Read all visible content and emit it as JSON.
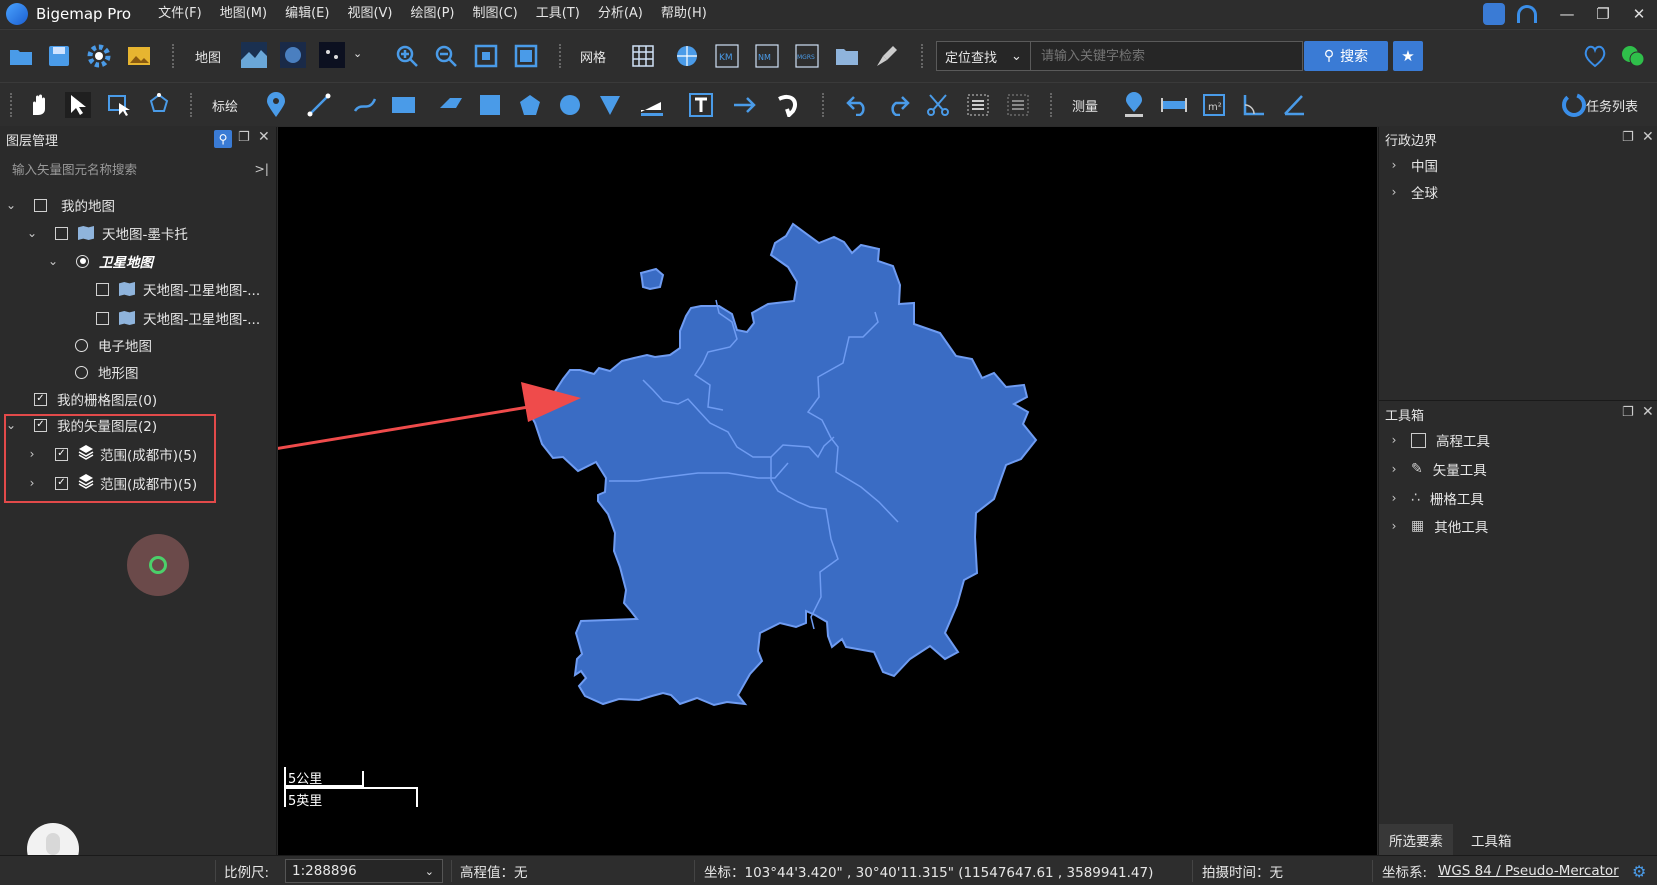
{
  "app": {
    "name": "Bigemap Pro"
  },
  "menu": [
    "文件(F)",
    "地图(M)",
    "编辑(E)",
    "视图(V)",
    "绘图(P)",
    "制图(C)",
    "工具(T)",
    "分析(A)",
    "帮助(H)"
  ],
  "toolbar1": {
    "map_label": "地图",
    "grid_label": "网格",
    "search_type": "定位查找",
    "search_placeholder": "请输入关键字检索",
    "search_button": "搜索"
  },
  "toolbar2": {
    "mark_label": "标绘",
    "measure_label": "测量",
    "task_list": "任务列表"
  },
  "left_panel": {
    "title": "图层管理",
    "search_placeholder": "输入矢量图元名称搜索",
    "tree": [
      {
        "label": "我的地图",
        "checked": false
      },
      {
        "label": "天地图-墨卡托",
        "checked": false
      },
      {
        "label": "卫星地图",
        "selected": true
      },
      {
        "label": "天地图-卫星地图-...",
        "checked": false
      },
      {
        "label": "天地图-卫星地图-...",
        "checked": false
      },
      {
        "label": "电子地图",
        "selected": false
      },
      {
        "label": "地形图",
        "selected": false
      },
      {
        "label": "我的栅格图层(0)",
        "checked": true
      },
      {
        "label": "我的矢量图层(2)",
        "checked": true
      },
      {
        "label": "范围(成都市)(5)",
        "checked": true
      },
      {
        "label": "范围(成都市)(5)",
        "checked": true
      }
    ]
  },
  "map": {
    "scale_km": "5公里",
    "scale_mi": "5英里",
    "region_fill": "#3a6cc4",
    "region_stroke": "#6f9cf2",
    "annotation_color": "#ef4b4b"
  },
  "right_panel": {
    "admin_title": "行政边界",
    "admin_items": [
      "中国",
      "全球"
    ],
    "toolbox_title": "工具箱",
    "tools": [
      "高程工具",
      "矢量工具",
      "栅格工具",
      "其他工具"
    ],
    "tabs": [
      "所选要素",
      "工具箱"
    ]
  },
  "status": {
    "scale_label": "比例尺:",
    "scale_value": "1:288896",
    "elevation": "高程值：无",
    "coords": "坐标：103°44'3.420\" , 30°40'11.315\"   (11547647.61 , 3589941.47)",
    "capture_time": "拍摄时间：无",
    "crs_label": "坐标系:",
    "crs_value": "WGS 84 / Pseudo-Mercator"
  }
}
